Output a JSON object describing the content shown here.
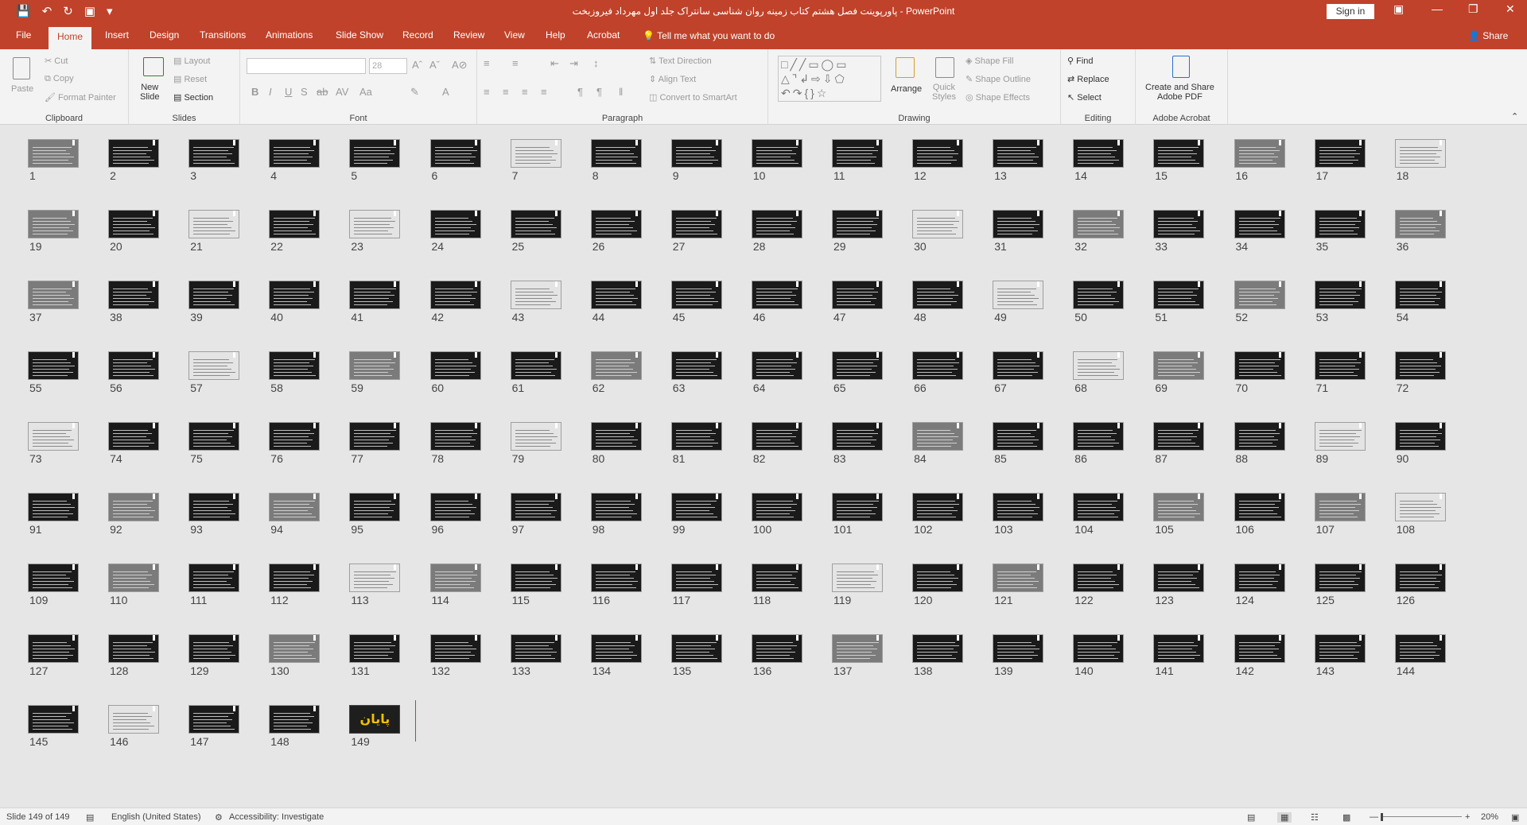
{
  "titlebar": {
    "title": "پاورپوینت فصل هشتم کتاب زمینه روان شناسی سانتراک جلد اول مهرداد فیروزبخت  -  PowerPoint",
    "sign_in": "Sign in"
  },
  "tabs": [
    "File",
    "Home",
    "Insert",
    "Design",
    "Transitions",
    "Animations",
    "Slide Show",
    "Record",
    "Review",
    "View",
    "Help",
    "Acrobat"
  ],
  "tell_me": "Tell me what you want to do",
  "share": "Share",
  "ribbon": {
    "clipboard": {
      "label": "Clipboard",
      "paste": "Paste",
      "cut": "Cut",
      "copy": "Copy",
      "format_painter": "Format Painter"
    },
    "slides": {
      "label": "Slides",
      "new_slide": "New\nSlide",
      "layout": "Layout",
      "reset": "Reset",
      "section": "Section"
    },
    "font": {
      "label": "Font",
      "size": "28"
    },
    "paragraph": {
      "label": "Paragraph",
      "text_direction": "Text Direction",
      "align_text": "Align Text",
      "convert": "Convert to SmartArt"
    },
    "drawing": {
      "label": "Drawing",
      "arrange": "Arrange",
      "quick_styles": "Quick\nStyles",
      "shape_fill": "Shape Fill",
      "shape_outline": "Shape Outline",
      "shape_effects": "Shape Effects"
    },
    "editing": {
      "label": "Editing",
      "find": "Find",
      "replace": "Replace",
      "select": "Select"
    },
    "acrobat": {
      "label": "Adobe Acrobat",
      "create": "Create and Share\nAdobe PDF"
    }
  },
  "slides": {
    "count": 149,
    "light": [
      7,
      18,
      30,
      43,
      49,
      57,
      68,
      73,
      79,
      89,
      108,
      119,
      146,
      113,
      23,
      21
    ],
    "picture": [
      1,
      16,
      19,
      32,
      36,
      37,
      52,
      59,
      62,
      69,
      84,
      94,
      105,
      107,
      110,
      114,
      121,
      130,
      137,
      92
    ],
    "end_slide": {
      "number": "149",
      "text": "پایان"
    }
  },
  "status": {
    "slide_info": "Slide 149 of 149",
    "language": "English (United States)",
    "accessibility": "Accessibility: Investigate",
    "zoom": "20%"
  }
}
